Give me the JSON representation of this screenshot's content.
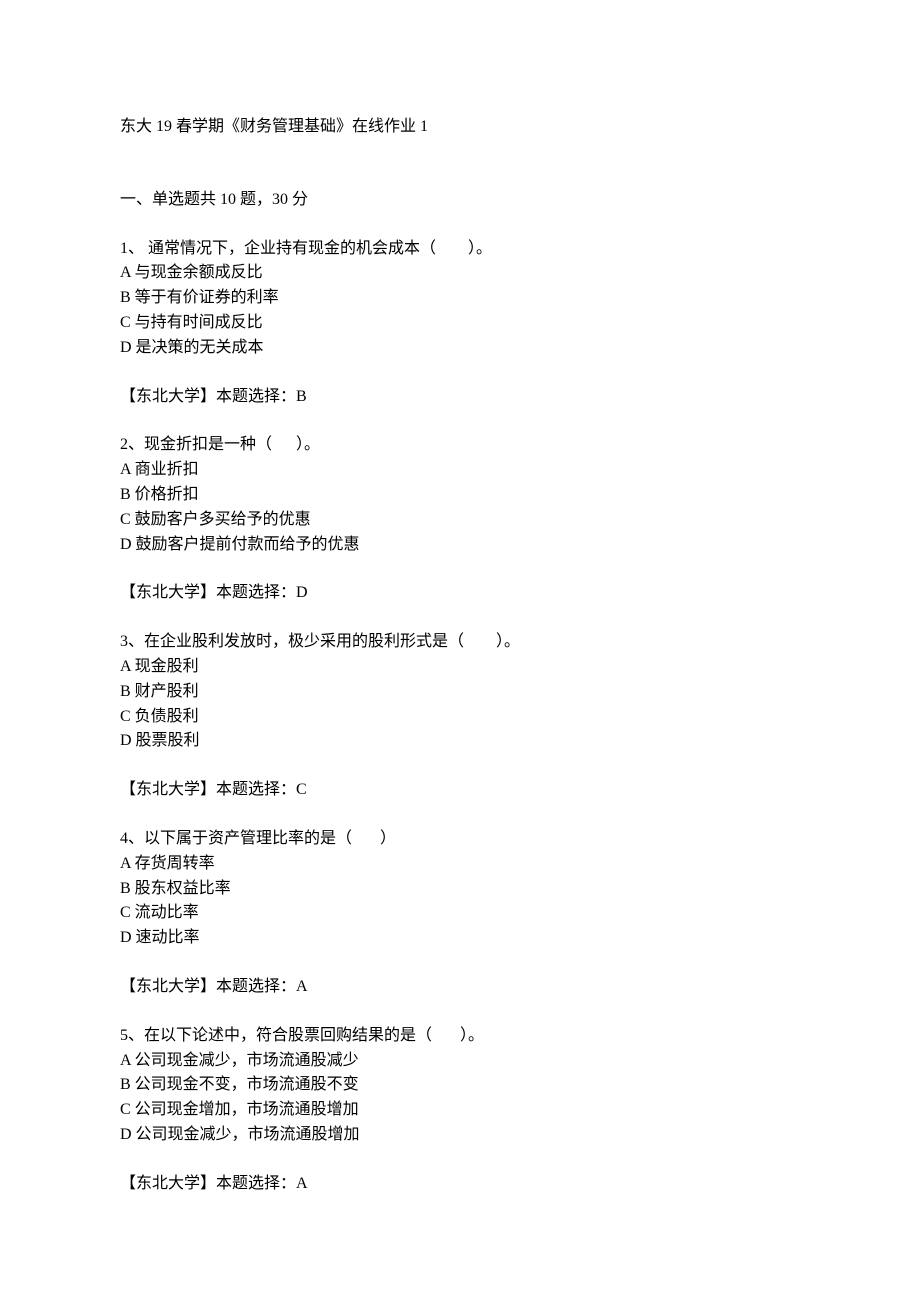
{
  "title": "东大 19 春学期《财务管理基础》在线作业 1",
  "section_header": "一、单选题共 10 题，30 分",
  "questions": [
    {
      "stem": "1、 通常情况下，企业持有现金的机会成本（        ）。",
      "options": [
        "A 与现金余额成反比",
        "B 等于有价证券的利率",
        "C 与持有时间成反比",
        "D 是决策的无关成本"
      ],
      "answer": "【东北大学】本题选择：B"
    },
    {
      "stem": "2、现金折扣是一种（      ）。",
      "options": [
        "A 商业折扣",
        "B 价格折扣",
        "C 鼓励客户多买给予的优惠",
        "D 鼓励客户提前付款而给予的优惠"
      ],
      "answer": "【东北大学】本题选择：D"
    },
    {
      "stem": "3、在企业股利发放时，极少采用的股利形式是（        ）。",
      "options": [
        "A 现金股利",
        "B 财产股利",
        "C 负债股利",
        "D 股票股利"
      ],
      "answer": "【东北大学】本题选择：C"
    },
    {
      "stem": "4、以下属于资产管理比率的是（       ）",
      "options": [
        "A 存货周转率",
        "B 股东权益比率",
        "C 流动比率",
        "D 速动比率"
      ],
      "answer": "【东北大学】本题选择：A"
    },
    {
      "stem": "5、在以下论述中，符合股票回购结果的是（       ）。",
      "options": [
        "A 公司现金减少，市场流通股减少",
        "B 公司现金不变，市场流通股不变",
        "C 公司现金增加，市场流通股增加",
        "D 公司现金减少，市场流通股增加"
      ],
      "answer": "【东北大学】本题选择：A"
    }
  ]
}
